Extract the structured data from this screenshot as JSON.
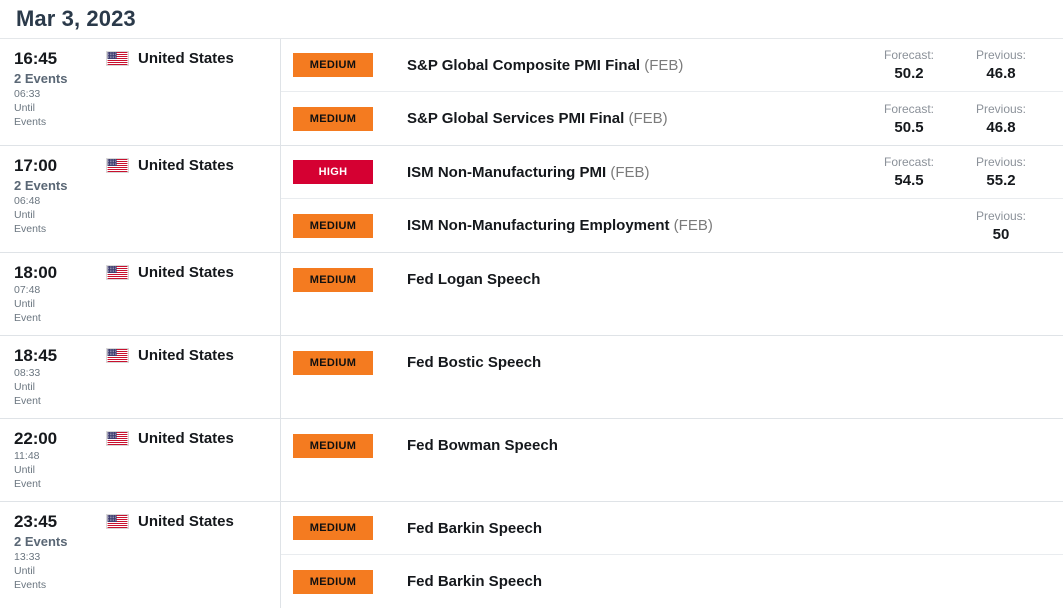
{
  "header": {
    "date": "Mar 3, 2023"
  },
  "labels": {
    "forecast": "Forecast:",
    "previous": "Previous:",
    "until": "Until"
  },
  "colors": {
    "badge_medium": "#F47B20",
    "badge_high": "#D50032",
    "title": "#2B3A4A"
  },
  "groups": [
    {
      "time": "16:45",
      "count_label": "2 Events",
      "countdown": "06:33",
      "until": "Until",
      "unit": "Events",
      "country": "United States",
      "flag": "us-flag-icon",
      "events": [
        {
          "impact": "MEDIUM",
          "impact_level": "medium",
          "title": "S&P Global Composite PMI Final",
          "period": "(FEB)",
          "forecast_label": "Forecast:",
          "forecast": "50.2",
          "previous_label": "Previous:",
          "previous": "46.8"
        },
        {
          "impact": "MEDIUM",
          "impact_level": "medium",
          "title": "S&P Global Services PMI Final",
          "period": "(FEB)",
          "forecast_label": "Forecast:",
          "forecast": "50.5",
          "previous_label": "Previous:",
          "previous": "46.8"
        }
      ]
    },
    {
      "time": "17:00",
      "count_label": "2 Events",
      "countdown": "06:48",
      "until": "Until",
      "unit": "Events",
      "country": "United States",
      "flag": "us-flag-icon",
      "events": [
        {
          "impact": "HIGH",
          "impact_level": "high",
          "title": "ISM Non-Manufacturing PMI",
          "period": "(FEB)",
          "forecast_label": "Forecast:",
          "forecast": "54.5",
          "previous_label": "Previous:",
          "previous": "55.2"
        },
        {
          "impact": "MEDIUM",
          "impact_level": "medium",
          "title": "ISM Non-Manufacturing Employment",
          "period": "(FEB)",
          "forecast_label": "",
          "forecast": "",
          "previous_label": "Previous:",
          "previous": "50"
        }
      ]
    },
    {
      "time": "18:00",
      "count_label": "",
      "countdown": "07:48",
      "until": "Until",
      "unit": "Event",
      "country": "United States",
      "flag": "us-flag-icon",
      "events": [
        {
          "impact": "MEDIUM",
          "impact_level": "medium",
          "title": "Fed Logan Speech",
          "period": "",
          "forecast_label": "",
          "forecast": "",
          "previous_label": "",
          "previous": ""
        }
      ]
    },
    {
      "time": "18:45",
      "count_label": "",
      "countdown": "08:33",
      "until": "Until",
      "unit": "Event",
      "country": "United States",
      "flag": "us-flag-icon",
      "events": [
        {
          "impact": "MEDIUM",
          "impact_level": "medium",
          "title": "Fed Bostic Speech",
          "period": "",
          "forecast_label": "",
          "forecast": "",
          "previous_label": "",
          "previous": ""
        }
      ]
    },
    {
      "time": "22:00",
      "count_label": "",
      "countdown": "11:48",
      "until": "Until",
      "unit": "Event",
      "country": "United States",
      "flag": "us-flag-icon",
      "events": [
        {
          "impact": "MEDIUM",
          "impact_level": "medium",
          "title": "Fed Bowman Speech",
          "period": "",
          "forecast_label": "",
          "forecast": "",
          "previous_label": "",
          "previous": ""
        }
      ]
    },
    {
      "time": "23:45",
      "count_label": "2 Events",
      "countdown": "13:33",
      "until": "Until",
      "unit": "Events",
      "country": "United States",
      "flag": "us-flag-icon",
      "events": [
        {
          "impact": "MEDIUM",
          "impact_level": "medium",
          "title": "Fed Barkin Speech",
          "period": "",
          "forecast_label": "",
          "forecast": "",
          "previous_label": "",
          "previous": ""
        },
        {
          "impact": "MEDIUM",
          "impact_level": "medium",
          "title": "Fed Barkin Speech",
          "period": "",
          "forecast_label": "",
          "forecast": "",
          "previous_label": "",
          "previous": ""
        }
      ]
    }
  ]
}
